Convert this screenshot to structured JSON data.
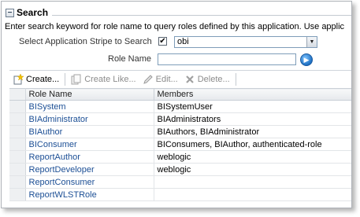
{
  "search": {
    "title": "Search",
    "instructions": "Enter search keyword for role name to query roles defined by this application. Use applic",
    "stripe_label": "Select Application Stripe to Search",
    "stripe_checked": "✔",
    "stripe_value": "obi",
    "role_name_label": "Role Name",
    "role_name_value": ""
  },
  "toolbar": {
    "create": "Create...",
    "create_like": "Create Like...",
    "edit": "Edit...",
    "delete": "Delete..."
  },
  "table": {
    "columns": [
      "Role Name",
      "Members"
    ],
    "rows": [
      {
        "name": "BISystem",
        "members": "BISystemUser"
      },
      {
        "name": "BIAdministrator",
        "members": "BIAdministrators"
      },
      {
        "name": "BIAuthor",
        "members": "BIAuthors, BIAdministrator"
      },
      {
        "name": "BIConsumer",
        "members": "BIConsumers, BIAuthor, authenticated-role"
      },
      {
        "name": "ReportAuthor",
        "members": "weblogic"
      },
      {
        "name": "ReportDeveloper",
        "members": "weblogic"
      },
      {
        "name": "ReportConsumer",
        "members": ""
      },
      {
        "name": "ReportWLSTRole",
        "members": ""
      }
    ]
  }
}
